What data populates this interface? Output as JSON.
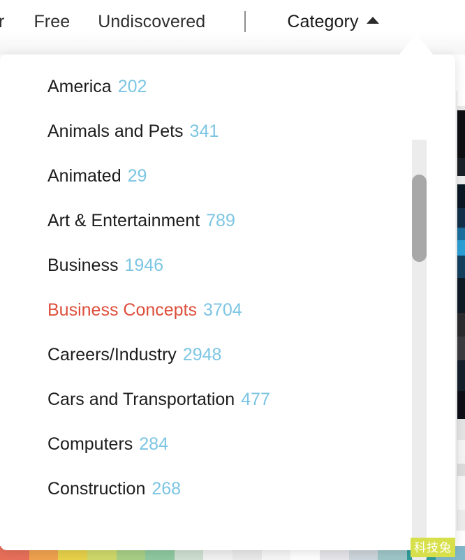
{
  "topbar": {
    "tabs": [
      {
        "label": "ar",
        "clipped": true,
        "active": false
      },
      {
        "label": "Free",
        "clipped": false,
        "active": false
      },
      {
        "label": "Undiscovered",
        "clipped": false,
        "active": false
      }
    ],
    "separator": "|",
    "active_tab": {
      "label": "Category",
      "caret_icon": "caret-up-icon",
      "expanded": true
    }
  },
  "dropdown": {
    "name": "category-dropdown",
    "scrollbar": {
      "name": "vertical-scrollbar",
      "thumb_position_pct": 8
    },
    "items": [
      {
        "label": "America",
        "count": "202",
        "selected": false
      },
      {
        "label": "Animals and Pets",
        "count": "341",
        "selected": false
      },
      {
        "label": "Animated",
        "count": "29",
        "selected": false
      },
      {
        "label": "Art & Entertainment",
        "count": "789",
        "selected": false
      },
      {
        "label": "Business",
        "count": "1946",
        "selected": false
      },
      {
        "label": "Business Concepts",
        "count": "3704",
        "selected": true
      },
      {
        "label": "Careers/Industry",
        "count": "2948",
        "selected": false
      },
      {
        "label": "Cars and Transportation",
        "count": "477",
        "selected": false
      },
      {
        "label": "Computers",
        "count": "284",
        "selected": false
      },
      {
        "label": "Construction",
        "count": "268",
        "selected": false
      }
    ]
  },
  "watermark": {
    "text": "科技兔"
  },
  "colors": {
    "count_blue": "#7cc5e3",
    "selected_red": "#de4f3c",
    "text_dark": "#1c1c1c",
    "tab_text": "#2f2f2f",
    "scrollbar_track": "#ececec",
    "scrollbar_thumb": "#a8a8a8",
    "watermark_bg": "#d7e04a",
    "panel_bg": "#ffffff"
  },
  "bg_tiles": [
    "#e8705a",
    "#f0a24e",
    "#e8d24a",
    "#cfd96a",
    "#a8cf86",
    "#8fc9a0",
    "#cfe0d2",
    "#f2f2f2",
    "#eaeaea",
    "#f7f7f7",
    "#ffffff",
    "#e6e6ea",
    "#cdd6dc",
    "#9ec6c9",
    "#2f9d9a",
    "#7fb6c8"
  ]
}
